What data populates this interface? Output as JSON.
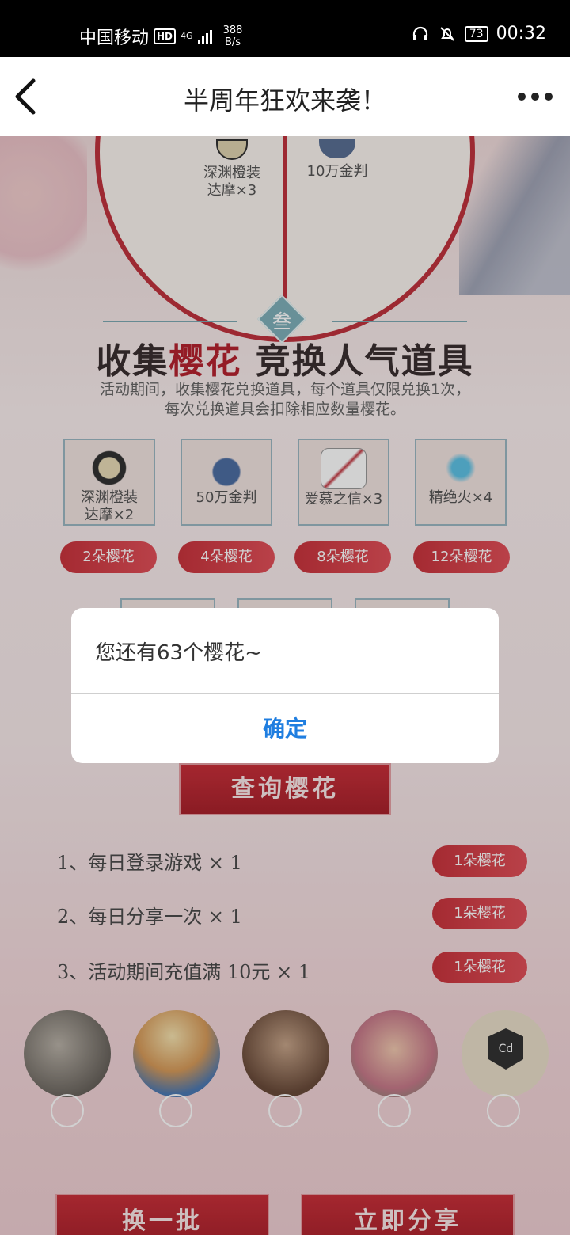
{
  "status_bar": {
    "carrier": "中国移动",
    "hd_badge": "HD",
    "network": "4G",
    "net_speed_value": "388",
    "net_speed_unit": "B/s",
    "battery": "73",
    "time": "00:32",
    "icons": [
      "headset-icon",
      "bell-muted-icon"
    ]
  },
  "nav": {
    "title": "半周年狂欢来袭！",
    "back_icon": "chevron-left-icon",
    "more_icon": "more-dots-icon"
  },
  "wheel": {
    "items": [
      {
        "name_line1": "深渊橙装",
        "name_line2": "达摩×3"
      },
      {
        "name_line1": "10万金判",
        "name_line2": ""
      }
    ]
  },
  "section3": {
    "badge": "叁",
    "title_part1": "收集",
    "title_part2": "樱花",
    "title_part3": " 竞换人气道具",
    "desc_line1": "活动期间，收集樱花兑换道具，每个道具仅限兑换1次，",
    "desc_line2": "每次兑换道具会扣除相应数量樱花。",
    "items": [
      {
        "name_line1": "深渊橙装",
        "name_line2": "达摩×2",
        "price": "2朵樱花"
      },
      {
        "name_line1": "50万金判",
        "name_line2": "",
        "price": "4朵樱花"
      },
      {
        "name_line1": "爱慕之信×3",
        "name_line2": "",
        "price": "8朵樱花"
      },
      {
        "name_line1": "精绝火×4",
        "name_line2": "",
        "price": "12朵樱花"
      }
    ]
  },
  "query_button": "查询樱花",
  "tasks": [
    {
      "text": "1、每日登录游戏 × 1",
      "reward": "1朵樱花"
    },
    {
      "text": "2、每日分享一次 × 1",
      "reward": "1朵樱花"
    },
    {
      "text": "3、活动期间充值满 10元 × 1",
      "reward": "1朵樱花"
    }
  ],
  "friend_badge": "Cd",
  "bottom_buttons": {
    "refresh": "换一批",
    "share": "立即分享"
  },
  "dialog": {
    "message": "您还有63个樱花~",
    "confirm": "确定"
  },
  "colors": {
    "accent_red": "#c0333d",
    "dialog_button": "#1f7ee0",
    "teal": "#7fb0ba"
  }
}
